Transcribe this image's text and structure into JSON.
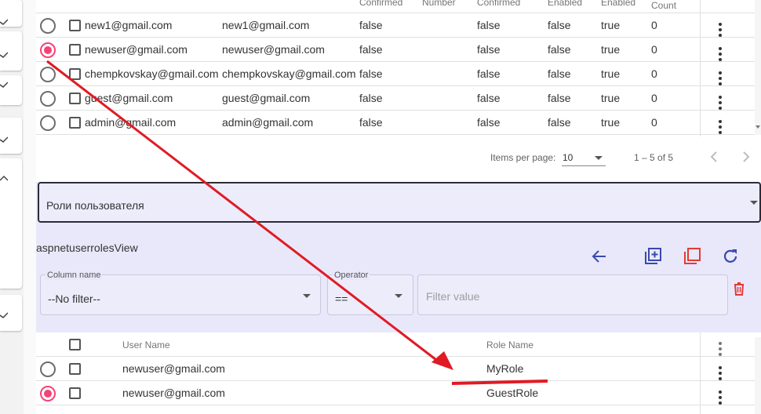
{
  "users_table": {
    "header_fragments": [
      "Confirmed",
      "Number",
      "Confirmed",
      "Enabled",
      "Enabled"
    ],
    "header_count": "Count",
    "rows": [
      {
        "email": "new1@gmail.com",
        "username": "new1@gmail.com",
        "c1": "false",
        "c2": "false",
        "c3": "false",
        "c4": "true",
        "count": "0",
        "selected": false
      },
      {
        "email": "newuser@gmail.com",
        "username": "newuser@gmail.com",
        "c1": "false",
        "c2": "false",
        "c3": "false",
        "c4": "true",
        "count": "0",
        "selected": true
      },
      {
        "email": "chempkovskay@gmail.com",
        "username": "chempkovskay@gmail.com",
        "c1": "false",
        "c2": "false",
        "c3": "false",
        "c4": "true",
        "count": "0",
        "selected": false
      },
      {
        "email": "guest@gmail.com",
        "username": "guest@gmail.com",
        "c1": "false",
        "c2": "false",
        "c3": "false",
        "c4": "true",
        "count": "0",
        "selected": false
      },
      {
        "email": "admin@gmail.com",
        "username": "admin@gmail.com",
        "c1": "false",
        "c2": "false",
        "c3": "false",
        "c4": "true",
        "count": "0",
        "selected": false
      }
    ]
  },
  "paginator": {
    "items_per_page_label": "Items per page:",
    "page_size": "10",
    "range": "1 – 5 of 5"
  },
  "roles_panel": {
    "select_label": "Роли пользователя",
    "view_title": "aspnetuserrolesView",
    "filter": {
      "column_label": "Column name",
      "column_value": "--No filter--",
      "operator_label": "Operator",
      "operator_value": "==",
      "value_placeholder": "Filter value"
    }
  },
  "roles_table": {
    "columns": {
      "user_name": "User Name",
      "role_name": "Role Name"
    },
    "rows": [
      {
        "user": "newuser@gmail.com",
        "role": "MyRole",
        "selected": false
      },
      {
        "user": "newuser@gmail.com",
        "role": "GuestRole",
        "selected": true
      }
    ]
  },
  "colors": {
    "accent": "#f44376",
    "primary": "#3949ab",
    "danger": "#e53935",
    "annotation": "#e01b24",
    "panel": "#e8e8fa"
  },
  "icons": [
    "check-icon",
    "chevron-up-icon",
    "kebab-menu-icon",
    "chevron-left-icon",
    "chevron-right-icon",
    "arrow-back-icon",
    "library-add-icon",
    "copy-icon",
    "refresh-icon",
    "delete-icon",
    "dropdown-triangle-icon"
  ]
}
